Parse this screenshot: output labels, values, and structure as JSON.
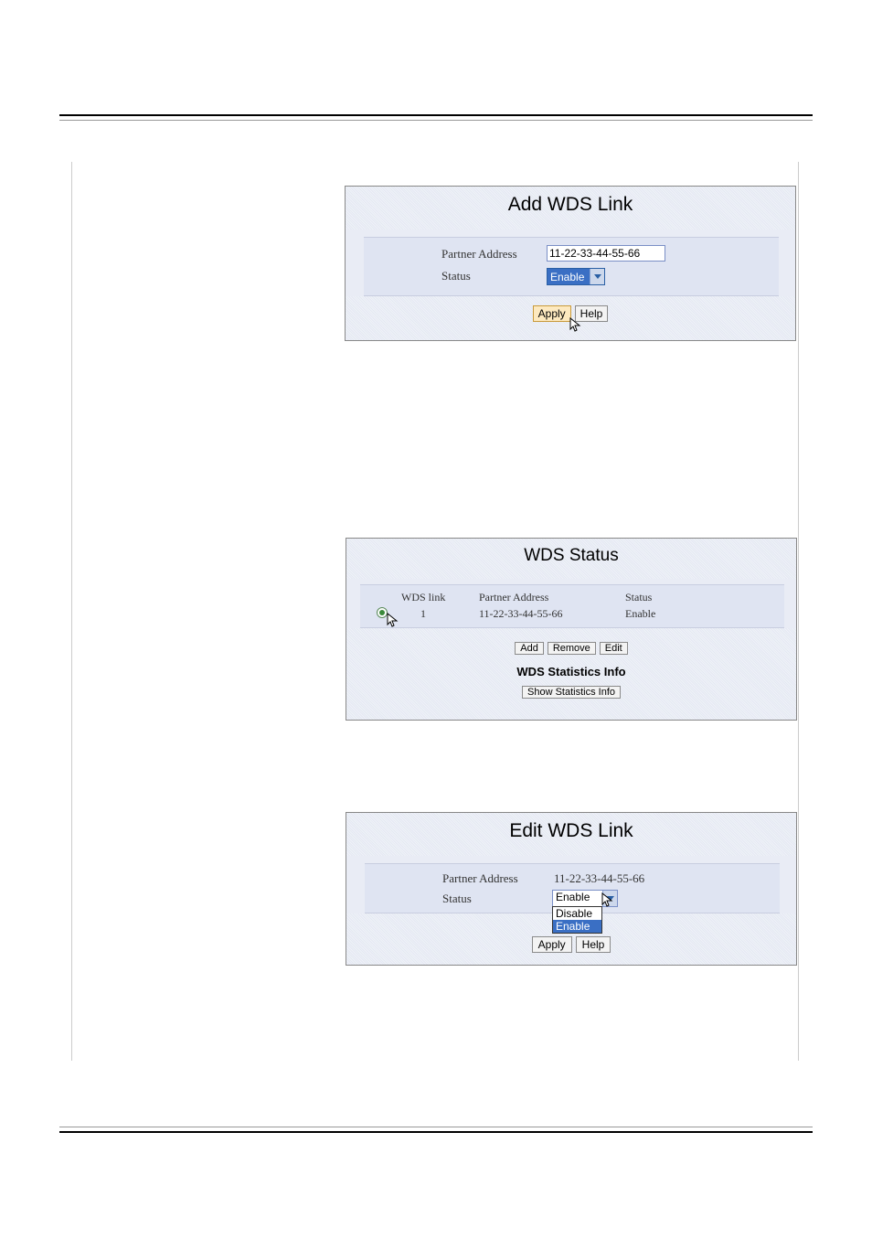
{
  "panel1": {
    "title": "Add WDS Link",
    "labels": {
      "partner": "Partner Address",
      "status": "Status"
    },
    "partner_value": "11-22-33-44-55-66",
    "status_value": "Enable",
    "buttons": {
      "apply": "Apply",
      "help": "Help"
    }
  },
  "panel2": {
    "title": "WDS Status",
    "headers": {
      "link": "WDS link",
      "partner": "Partner Address",
      "status": "Status"
    },
    "row": {
      "link": "1",
      "partner": "11-22-33-44-55-66",
      "status": "Enable"
    },
    "buttons": {
      "add": "Add",
      "remove": "Remove",
      "edit": "Edit",
      "show": "Show Statistics Info"
    },
    "subtitle": "WDS Statistics Info"
  },
  "panel3": {
    "title": "Edit WDS Link",
    "labels": {
      "partner": "Partner Address",
      "status": "Status"
    },
    "partner_value": "11-22-33-44-55-66",
    "status_value": "Enable",
    "options": {
      "disable": "Disable",
      "enable": "Enable"
    },
    "buttons": {
      "apply": "Apply",
      "help": "Help"
    }
  }
}
